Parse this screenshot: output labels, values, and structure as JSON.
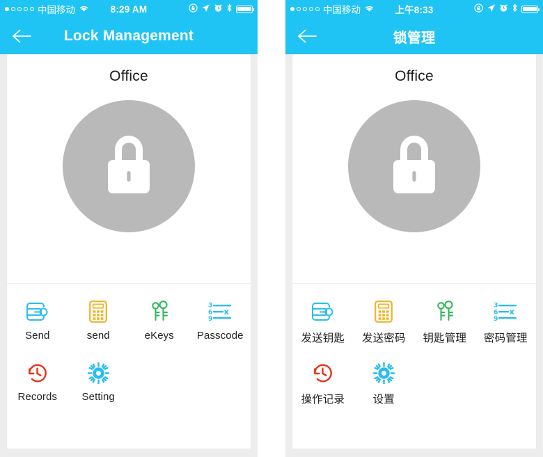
{
  "screens": [
    {
      "id": "english",
      "status_bar": {
        "signal_dots_filled": 1,
        "signal_dots_total": 5,
        "carrier": "中国移动",
        "wifi_icon": "wifi-icon",
        "time": "8:29 AM",
        "right_icons": [
          "rotation-lock-icon",
          "location-arrow-icon",
          "alarm-clock-icon",
          "bluetooth-icon",
          "battery-icon"
        ]
      },
      "nav": {
        "back_icon": "back-arrow-icon",
        "title": "Lock Management"
      },
      "lock": {
        "name": "Office",
        "icon": "padlock-icon",
        "circle_color": "#b9b9b9"
      },
      "actions": [
        {
          "label": "Send",
          "icon": "send-key-icon",
          "color": "#29bdf0"
        },
        {
          "label": "send",
          "icon": "send-passcode-icon",
          "color": "#f0b429"
        },
        {
          "label": "eKeys",
          "icon": "keys-manage-icon",
          "color": "#33b85a"
        },
        {
          "label": "Passcode",
          "icon": "passcode-manage-icon",
          "color": "#29bdf0"
        },
        {
          "label": "Records",
          "icon": "history-clock-icon",
          "color": "#e8301b"
        },
        {
          "label": "Setting",
          "icon": "gear-icon",
          "color": "#29bdf0"
        }
      ]
    },
    {
      "id": "chinese",
      "status_bar": {
        "signal_dots_filled": 1,
        "signal_dots_total": 5,
        "carrier": "中国移动",
        "wifi_icon": "wifi-icon",
        "time": "上午8:33",
        "right_icons": [
          "rotation-lock-icon",
          "location-arrow-icon",
          "alarm-clock-icon",
          "bluetooth-icon",
          "battery-icon"
        ]
      },
      "nav": {
        "back_icon": "back-arrow-icon",
        "title": "锁管理"
      },
      "lock": {
        "name": "Office",
        "icon": "padlock-icon",
        "circle_color": "#b9b9b9"
      },
      "actions": [
        {
          "label": "发送钥匙",
          "icon": "send-key-icon",
          "color": "#29bdf0"
        },
        {
          "label": "发送密码",
          "icon": "send-passcode-icon",
          "color": "#f0b429"
        },
        {
          "label": "钥匙管理",
          "icon": "keys-manage-icon",
          "color": "#33b85a"
        },
        {
          "label": "密码管理",
          "icon": "passcode-manage-icon",
          "color": "#29bdf0"
        },
        {
          "label": "操作记录",
          "icon": "history-clock-icon",
          "color": "#e8301b"
        },
        {
          "label": "设置",
          "icon": "gear-icon",
          "color": "#29bdf0"
        }
      ]
    }
  ],
  "theme": {
    "accent": "#20c4f4",
    "page_background": "#ededed",
    "card_background": "#ffffff",
    "text_primary": "#1c1c1c"
  }
}
